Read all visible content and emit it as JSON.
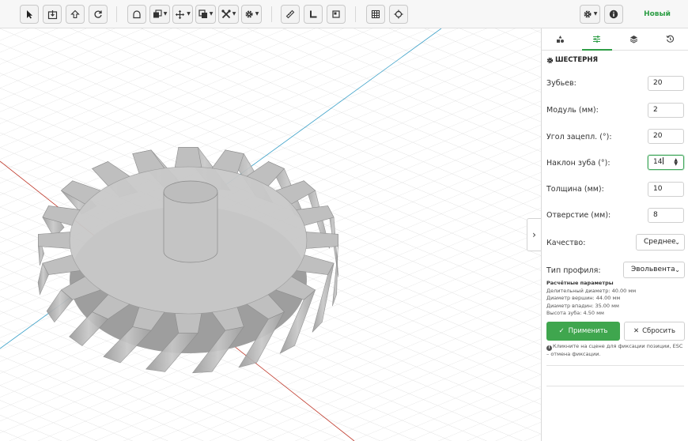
{
  "toolbar": {
    "new_project_label": "Новый проект",
    "buttons": [
      {
        "name": "select-tool",
        "icon": "cursor-icon"
      },
      {
        "name": "place-on-face-tool",
        "icon": "drop-to-face-icon"
      },
      {
        "name": "upload-tool",
        "icon": "arrow-up-icon"
      },
      {
        "name": "refresh-tool",
        "icon": "refresh-icon"
      },
      {
        "name": "shape-tool",
        "icon": "arch-icon"
      },
      {
        "name": "copy-menu",
        "icon": "copy-icon"
      },
      {
        "name": "move-menu",
        "icon": "move-icon"
      },
      {
        "name": "boolean-menu",
        "icon": "boolean-icon"
      },
      {
        "name": "tools-menu",
        "icon": "crossed-tools-icon"
      },
      {
        "name": "settings-menu",
        "icon": "gear-icon"
      },
      {
        "name": "measure-tool",
        "icon": "ruler-icon"
      },
      {
        "name": "angle-tool",
        "icon": "set-square-icon"
      },
      {
        "name": "crop-tool",
        "icon": "crop-icon"
      },
      {
        "name": "grid-toggle",
        "icon": "grid-icon"
      },
      {
        "name": "center-tool",
        "icon": "crosshair-icon"
      },
      {
        "name": "app-settings-menu",
        "icon": "gear-icon"
      },
      {
        "name": "info-button",
        "icon": "info-icon"
      }
    ]
  },
  "panel": {
    "tabs": [
      {
        "name": "tab-objects",
        "icon": "shapes-icon",
        "active": false
      },
      {
        "name": "tab-parameters",
        "icon": "sliders-icon",
        "active": true
      },
      {
        "name": "tab-layers",
        "icon": "layers-icon",
        "active": false
      },
      {
        "name": "tab-history",
        "icon": "history-icon",
        "active": false
      }
    ],
    "section_title": "ШЕСТЕРНЯ",
    "fields": {
      "teeth": {
        "label": "Зубьев:",
        "value": "20"
      },
      "module": {
        "label": "Модуль (мм):",
        "value": "2"
      },
      "pressure_angle": {
        "label": "Угол зацепл. (°):",
        "value": "20"
      },
      "helix_angle": {
        "label": "Наклон зуба (°):",
        "value": "14"
      },
      "thickness": {
        "label": "Толщина (мм):",
        "value": "10"
      },
      "bore": {
        "label": "Отверстие (мм):",
        "value": "8"
      }
    },
    "quality": {
      "label": "Качество:",
      "value": "Среднее"
    },
    "profile": {
      "label": "Тип профиля:",
      "value": "Эвольвента"
    },
    "calculated": {
      "title": "Расчётные параметры",
      "pitch_diameter": "Делительный диаметр: 40.00 мм",
      "tip_diameter": "Диаметр вершин: 44.00 мм",
      "root_diameter": "Диаметр впадин: 35.00 мм",
      "tooth_height": "Высота зуба: 4.50 мм"
    },
    "apply_label": "Применить",
    "reset_label": "Сбросить",
    "hint": "Кликните на сцене для фиксации позиции, ESC – отмена фиксации."
  },
  "scene": {
    "axis_x_color": "#c0392b",
    "axis_z_color": "#3aa0c8",
    "accent_color": "#2e9e46",
    "gear_color": "#a9a9a9"
  }
}
